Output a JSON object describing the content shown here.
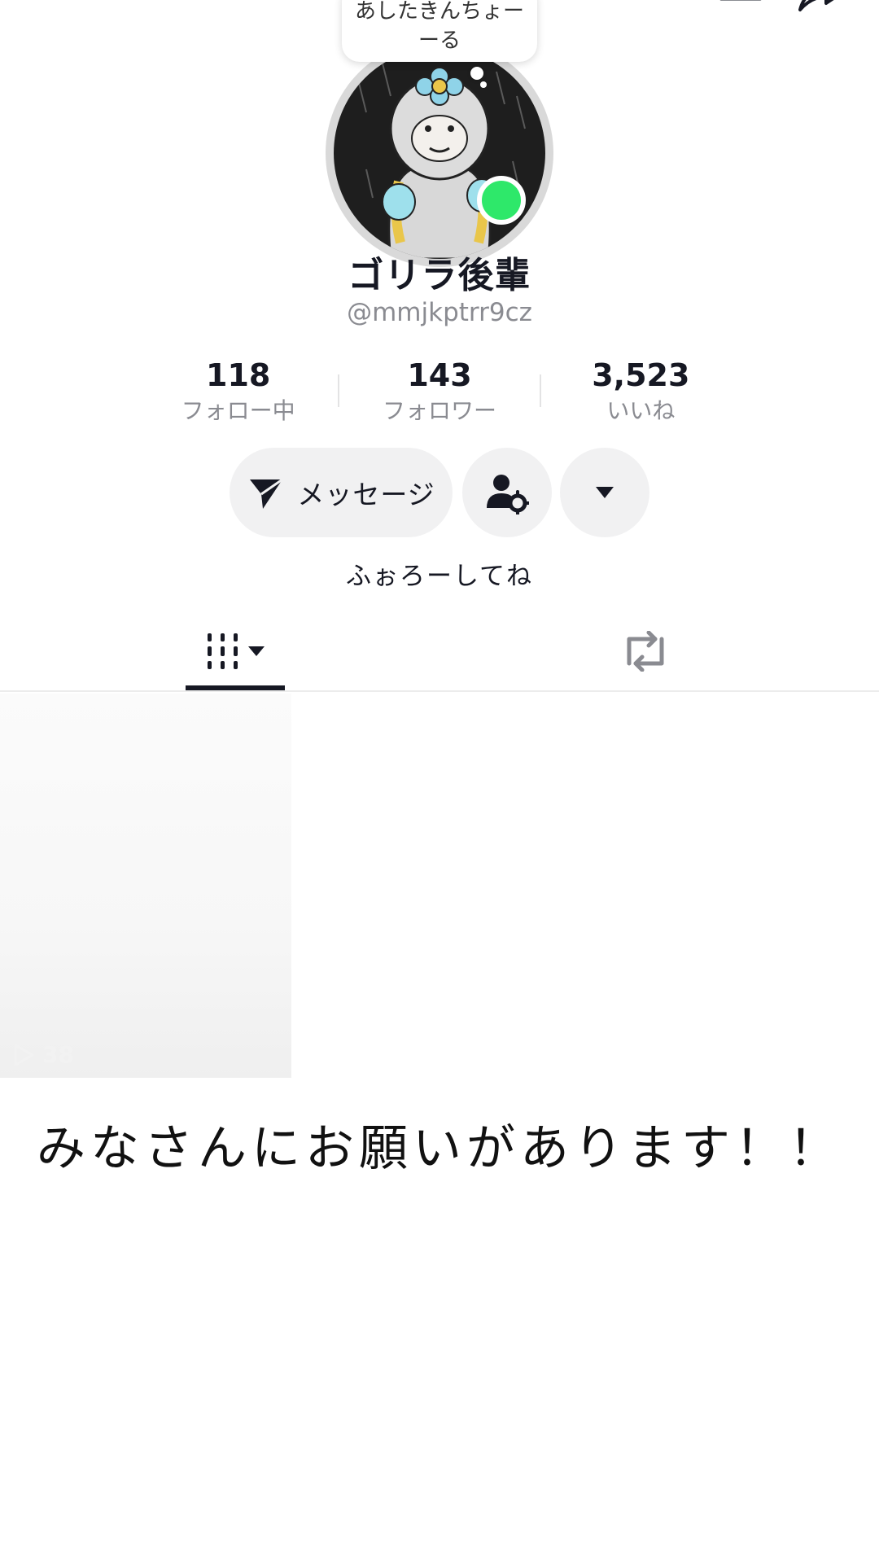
{
  "header": {
    "back_icon": "chevron-left-icon",
    "bell_icon": "bell-icon",
    "share_icon": "share-arrow-icon"
  },
  "profile": {
    "note": "あしたきんちょーーる",
    "display_name": "ゴリラ後輩",
    "handle": "@mmjkptrr9cz",
    "online_color": "#2ee86a",
    "bio": "ふぉろーしてね"
  },
  "stats": [
    {
      "value": "118",
      "label": "フォロー中"
    },
    {
      "value": "143",
      "label": "フォロワー"
    },
    {
      "value": "3,523",
      "label": "いいね"
    }
  ],
  "actions": {
    "message_label": "メッセージ",
    "message_icon": "send-icon",
    "follow_settings_icon": "user-gear-icon",
    "more_icon": "caret-down-icon"
  },
  "tabs": [
    {
      "name": "videos",
      "icon": "grid-bars-icon",
      "active": true
    },
    {
      "name": "reposts",
      "icon": "repost-icon",
      "active": false
    }
  ],
  "videos": [
    {
      "play_count": "38"
    }
  ],
  "caption": "みなさんにお願いがあります！！"
}
